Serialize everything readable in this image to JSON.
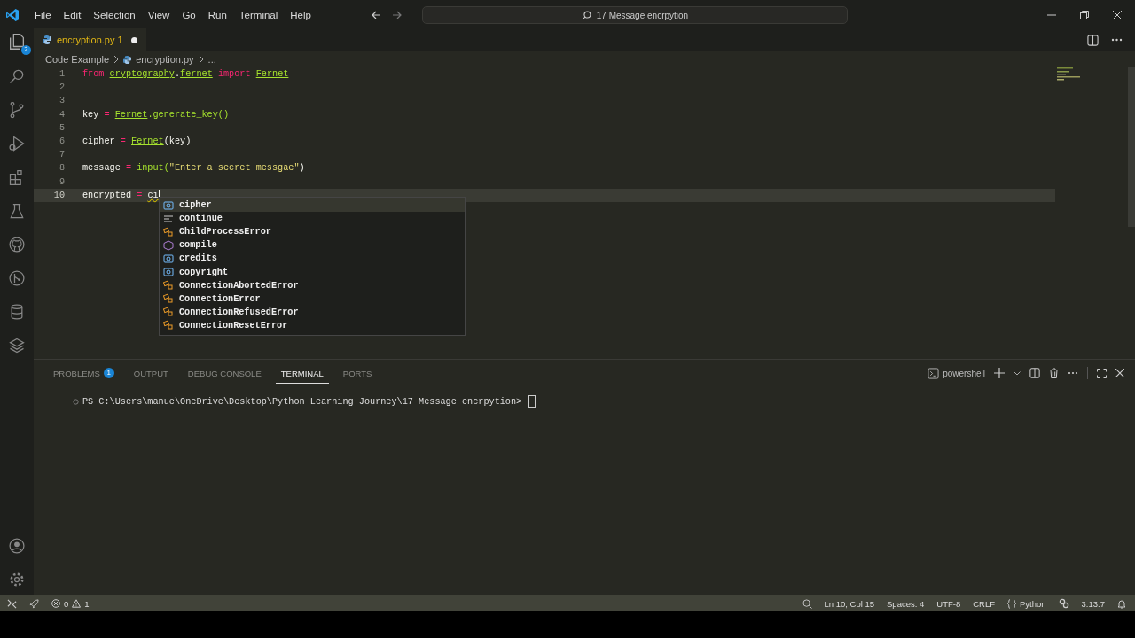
{
  "menu": [
    "File",
    "Edit",
    "Selection",
    "View",
    "Go",
    "Run",
    "Terminal",
    "Help"
  ],
  "command_center": {
    "text": "17 Message encrpytion"
  },
  "activity_bar": {
    "explorer_badge": "2"
  },
  "editor_tab": {
    "label": "encryption.py",
    "problems": "1",
    "dirty": true
  },
  "breadcrumb": [
    "Code Example",
    "encryption.py",
    "..."
  ],
  "lines": [
    {
      "number": "1",
      "tokens": [
        {
          "text": "from ",
          "kind": "keyword"
        },
        {
          "text": "cryptography",
          "kind": "warn"
        },
        {
          "text": ".",
          "kind": "plain"
        },
        {
          "text": "fernet",
          "kind": "warn"
        },
        {
          "text": " import ",
          "kind": "keyword"
        },
        {
          "text": "Fernet",
          "kind": "warn"
        }
      ]
    },
    {
      "number": "2"
    },
    {
      "number": "3"
    },
    {
      "number": "4",
      "tokens": [
        {
          "text": "key",
          "kind": "plain"
        },
        {
          "text": " = ",
          "kind": "op"
        },
        {
          "text": "Fernet",
          "kind": "warn"
        },
        {
          "text": ".generate_key()",
          "kind": "func"
        }
      ]
    },
    {
      "number": "5"
    },
    {
      "number": "6",
      "tokens": [
        {
          "text": "cipher",
          "kind": "plain"
        },
        {
          "text": " = ",
          "kind": "op"
        },
        {
          "text": "Fernet",
          "kind": "warn"
        },
        {
          "text": "(key)",
          "kind": "plain"
        }
      ]
    },
    {
      "number": "7"
    },
    {
      "number": "8",
      "tokens": [
        {
          "text": "message",
          "kind": "plain"
        },
        {
          "text": " = ",
          "kind": "op"
        },
        {
          "text": "input(",
          "kind": "func"
        },
        {
          "text": "\"Enter a secret messgae\"",
          "kind": "string"
        },
        {
          "text": ")",
          "kind": "plain"
        }
      ]
    },
    {
      "number": "9"
    },
    {
      "number": "10",
      "current": true,
      "tokens": [
        {
          "text": "encrypted",
          "kind": "plain"
        },
        {
          "text": " = ",
          "kind": "op"
        },
        {
          "text": "ci",
          "kind": "squiggle"
        }
      ]
    }
  ],
  "suggestions": [
    {
      "label": "cipher",
      "kind": "variable",
      "selected": true
    },
    {
      "label": "continue",
      "kind": "keyword",
      "selected": false
    },
    {
      "label": "ChildProcessError",
      "kind": "class",
      "selected": false
    },
    {
      "label": "compile",
      "kind": "function",
      "selected": false
    },
    {
      "label": "credits",
      "kind": "variable",
      "selected": false
    },
    {
      "label": "copyright",
      "kind": "variable",
      "selected": false
    },
    {
      "label": "ConnectionAbortedError",
      "kind": "class",
      "selected": false
    },
    {
      "label": "ConnectionError",
      "kind": "class",
      "selected": false
    },
    {
      "label": "ConnectionRefusedError",
      "kind": "class",
      "selected": false
    },
    {
      "label": "ConnectionResetError",
      "kind": "class",
      "selected": false
    }
  ],
  "panel_tabs": [
    {
      "label": "PROBLEMS",
      "badge": "1",
      "selected": false
    },
    {
      "label": "OUTPUT",
      "selected": false
    },
    {
      "label": "DEBUG CONSOLE",
      "selected": false
    },
    {
      "label": "TERMINAL",
      "selected": true
    },
    {
      "label": "PORTS",
      "selected": false
    }
  ],
  "terminal": {
    "shell": "powershell",
    "prompt": "PS C:\\Users\\manue\\OneDrive\\Desktop\\Python Learning Journey\\17 Message encrpytion>"
  },
  "status_bar": {
    "errors": "0",
    "warnings": "1",
    "position": "Ln 10, Col 15",
    "indent": "Spaces: 4",
    "encoding": "UTF-8",
    "eol": "CRLF",
    "language": "Python",
    "version": "3.13.7"
  }
}
